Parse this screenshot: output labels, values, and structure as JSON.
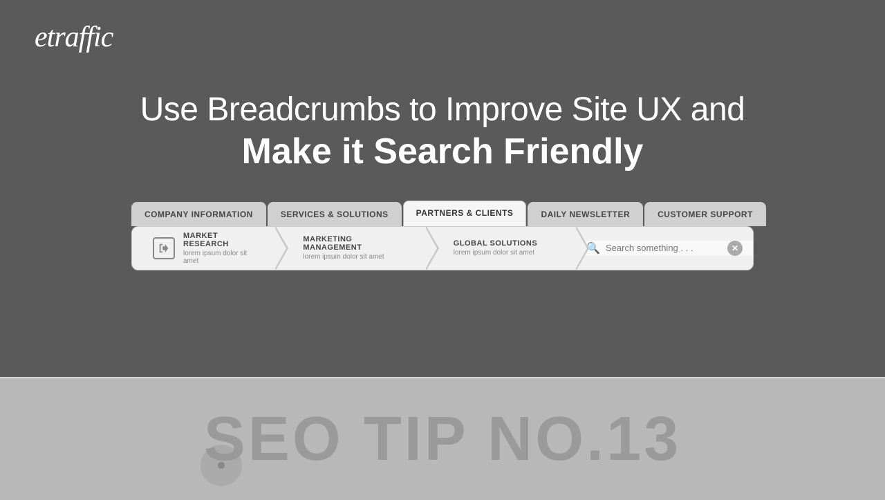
{
  "logo": {
    "text": "etraffic"
  },
  "headline": {
    "top": "Use Breadcrumbs to Improve Site UX and",
    "bottom": "Make it Search Friendly"
  },
  "tabs": [
    {
      "id": "company",
      "label": "COMPANY INFORMATION",
      "active": false
    },
    {
      "id": "services",
      "label": "SERVICES & SOLUTIONS",
      "active": false
    },
    {
      "id": "partners",
      "label": "PARTNERS & CLIENTS",
      "active": true
    },
    {
      "id": "newsletter",
      "label": "DAILY NEWSLETTER",
      "active": false
    },
    {
      "id": "support",
      "label": "CUSTOMER SUPPORT",
      "active": false
    }
  ],
  "breadcrumbs": [
    {
      "id": "market-research",
      "title": "MARKET RESEARCH",
      "sub": "lorem ipsum dolor sit amet",
      "hasIcon": true
    },
    {
      "id": "marketing-management",
      "title": "MARKETING MANAGEMENT",
      "sub": "lorem ipsum dolor sit amet",
      "hasIcon": false
    },
    {
      "id": "global-solutions",
      "title": "GLOBAL SOLUTIONS",
      "sub": "lorem ipsum dolor sit amet",
      "hasIcon": false
    }
  ],
  "search": {
    "placeholder": "Search something . . ."
  },
  "seo_tip": {
    "text": "SEO TIP NO.13"
  }
}
